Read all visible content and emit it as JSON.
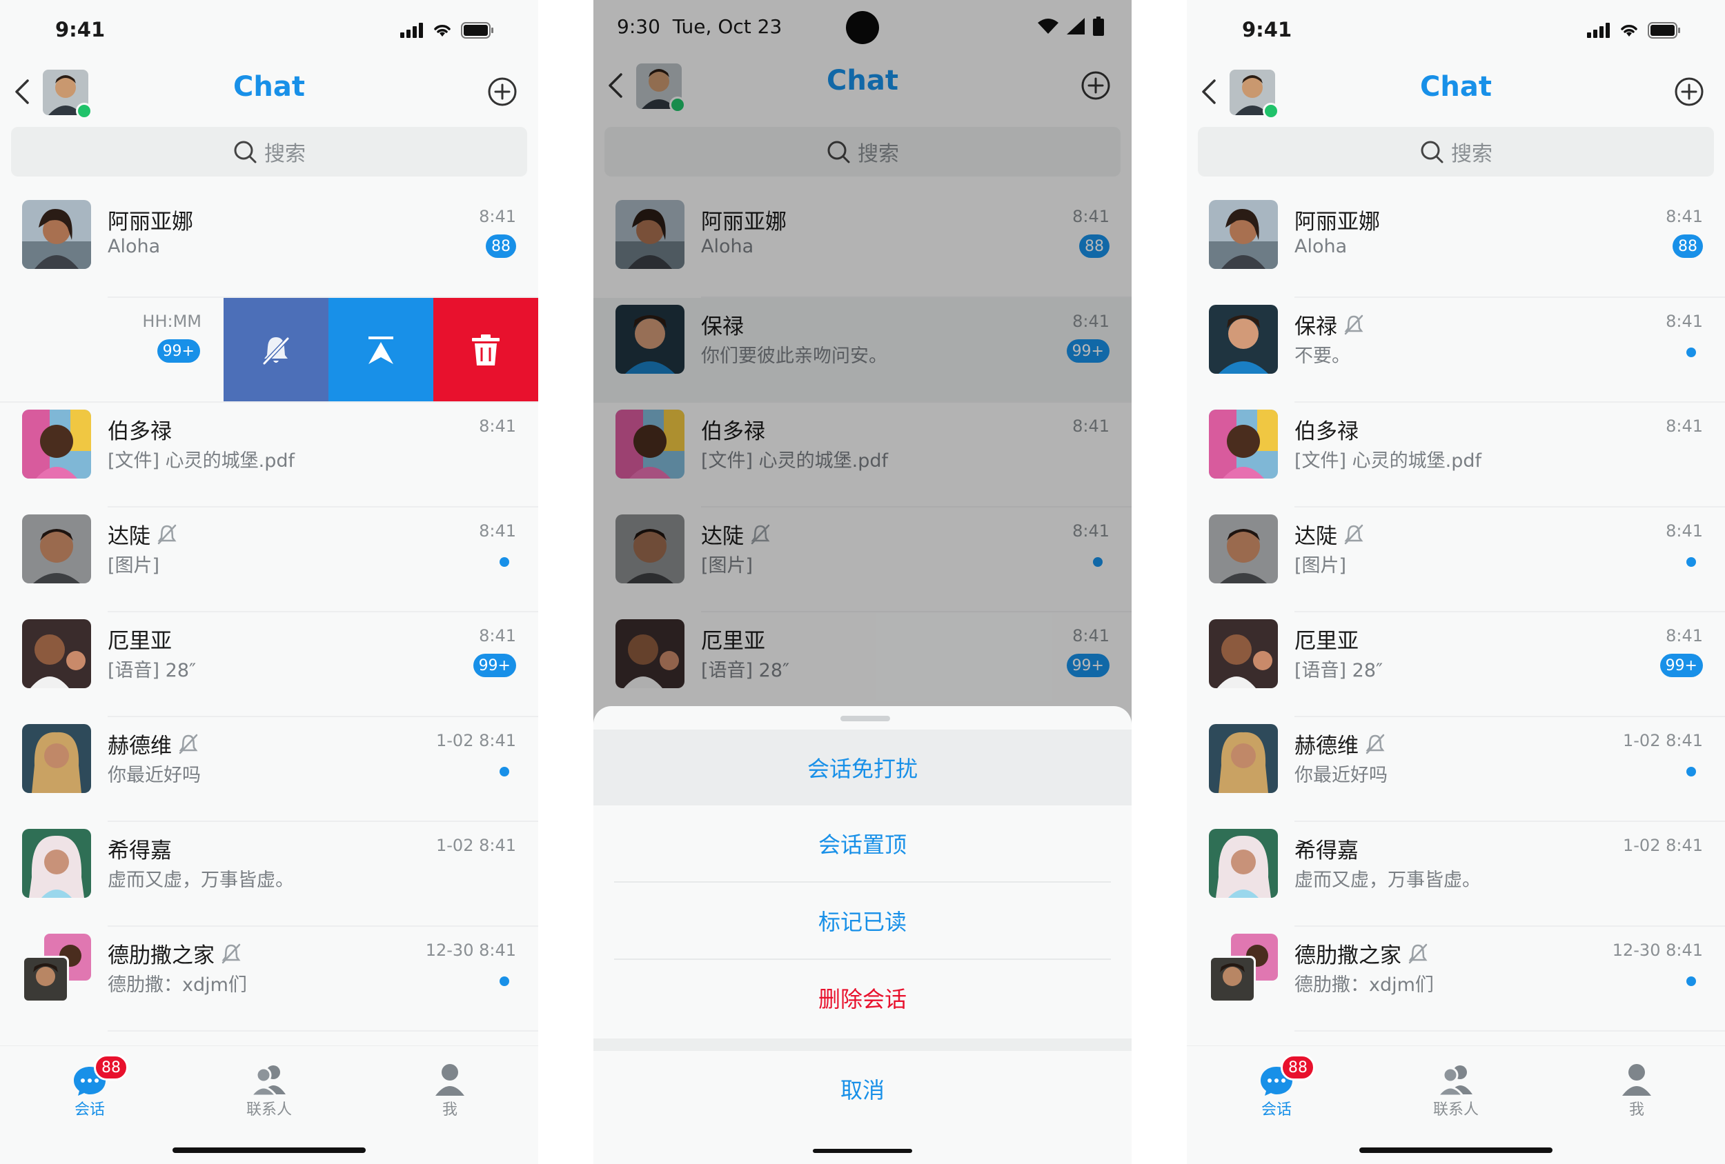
{
  "colors": {
    "accent": "#1890e8",
    "online": "#20c26a",
    "mute_action": "#4c6fb8",
    "delete": "#e8112d"
  },
  "header": {
    "title": "Chat"
  },
  "search": {
    "placeholder": "搜索"
  },
  "status_ios": {
    "time": "9:41"
  },
  "status_android": {
    "time": "9:30",
    "date": "Tue, Oct 23"
  },
  "chats": [
    {
      "name": "阿丽亚娜",
      "msg": "Aloha",
      "time": "8:41",
      "badge": "88",
      "muted": false
    },
    {
      "name": "保禄",
      "msg": "你们要彼此亲吻问安。",
      "time": "8:41",
      "badge": "99+",
      "muted": false
    },
    {
      "name": "伯多禄",
      "msg": "[文件] 心灵的城堡.pdf",
      "time": "8:41",
      "muted": false
    },
    {
      "name": "达陡",
      "msg": "[图片]",
      "time": "8:41",
      "dot": true,
      "muted": true
    },
    {
      "name": "厄里亚",
      "msg": "[语音] 28″",
      "time": "8:41",
      "badge": "99+",
      "muted": false
    },
    {
      "name": "赫德维",
      "msg": "你最近好吗",
      "time": "1-02 8:41",
      "dot": true,
      "muted": true
    },
    {
      "name": "希得嘉",
      "msg": "虚而又虚，万事皆虚。",
      "time": "1-02 8:41",
      "muted": false
    },
    {
      "name": "德肋撒之家",
      "msg": "德肋撒：xdjm们",
      "time": "12-30 8:41",
      "dot": true,
      "muted": true
    }
  ],
  "swipe_row": {
    "time": "HH:MM",
    "badge": "99+"
  },
  "right_row2": {
    "name": "保禄",
    "msg": "不要。",
    "time": "8:41"
  },
  "sheet": {
    "items": [
      "会话免打扰",
      "会话置顶",
      "标记已读",
      "删除会话"
    ],
    "cancel": "取消"
  },
  "tabs": [
    {
      "label": "会话",
      "badge": "88",
      "icon": "chat-bubble-icon"
    },
    {
      "label": "联系人",
      "icon": "contacts-icon"
    },
    {
      "label": "我",
      "icon": "person-icon"
    }
  ]
}
